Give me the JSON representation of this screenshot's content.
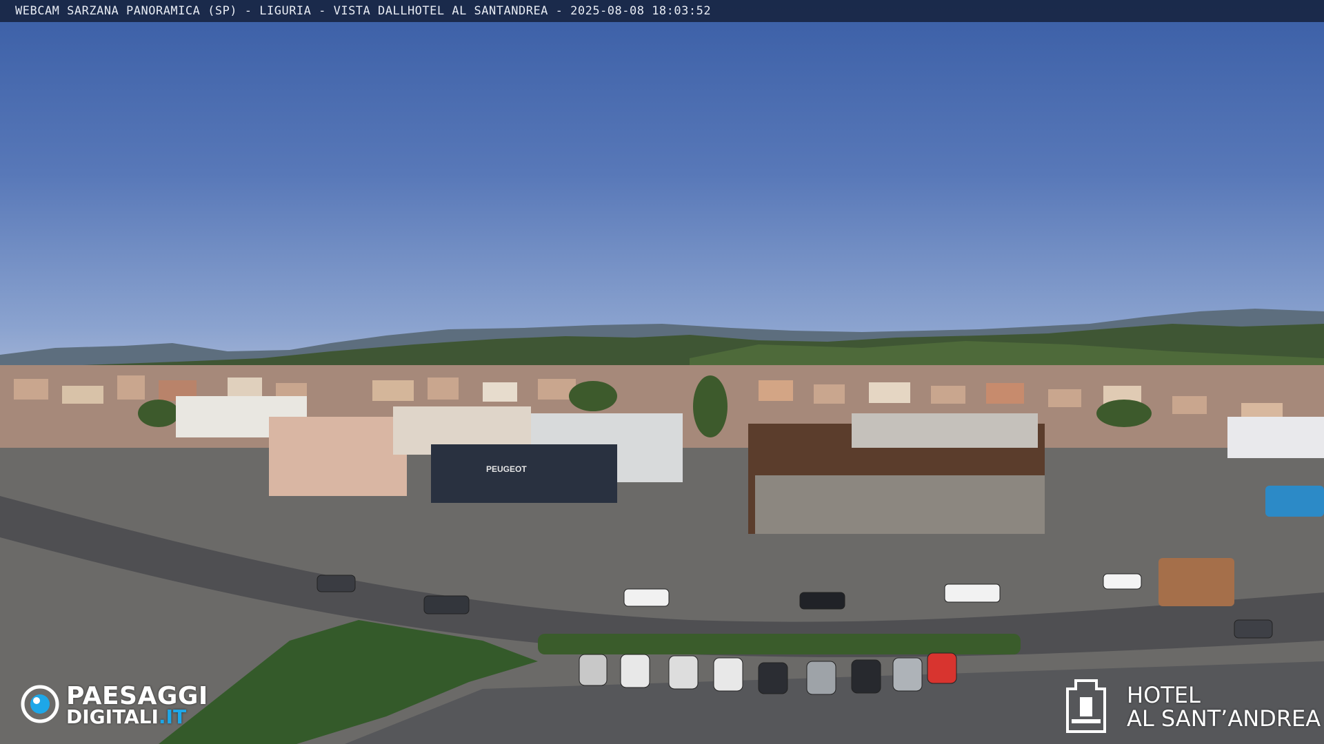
{
  "overlay": {
    "title": "WEBCAM SARZANA PANORAMICA (SP) - LIGURIA - VISTA DALLHOTEL AL SANTANDREA - 2025-08-08  18:03:52"
  },
  "logos": {
    "left_line1": "PAESAGGI",
    "left_line2_main": "DIGITALI",
    "left_line2_accent": ".IT",
    "right_line1": "HOTEL",
    "right_line2": "AL SANT’ANDREA"
  },
  "signs": {
    "dealer": "PEUGEOT"
  },
  "colors": {
    "sky_top": "#3a5ea6",
    "sky_bottom": "#a9b8d8",
    "logo_accent": "#1ea7e8"
  },
  "icons": {
    "left_logo": "eye-logo-icon",
    "right_logo": "hotel-emblem-icon"
  }
}
